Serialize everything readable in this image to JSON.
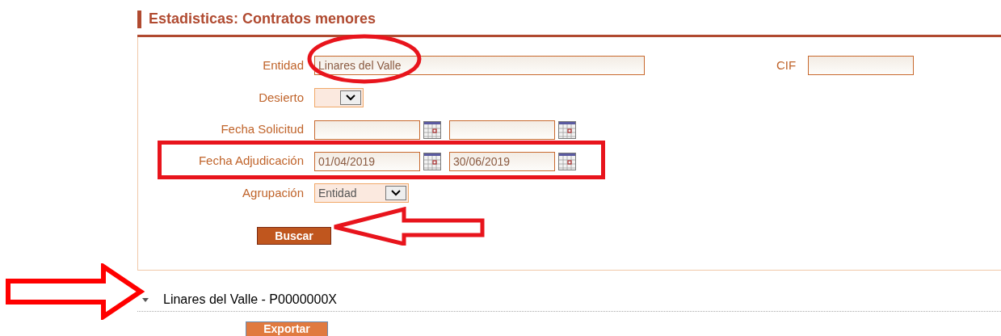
{
  "section_title": "Estadisticas: Contratos menores",
  "form": {
    "entidad": {
      "label": "Entidad",
      "value": "Linares del Valle"
    },
    "cif": {
      "label": "CIF"
    },
    "desierto": {
      "label": "Desierto"
    },
    "fecha_solicitud": {
      "label": "Fecha Solicitud"
    },
    "fecha_adjudicacion": {
      "label": "Fecha Adjudicación",
      "from": "01/04/2019",
      "to": "30/06/2019"
    },
    "agrupacion": {
      "label": "Agrupación",
      "value": "Entidad"
    },
    "search_button": "Buscar"
  },
  "results": [
    {
      "title": "Linares del Valle - P0000000X",
      "expanded": true,
      "export_button": "Exportar"
    }
  ]
}
